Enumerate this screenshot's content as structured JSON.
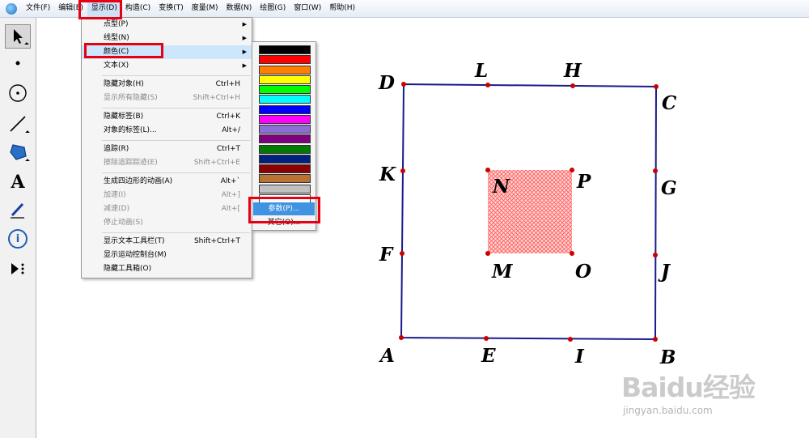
{
  "menubar": {
    "items": [
      "文件(F)",
      "编辑(E)",
      "显示(D)",
      "构造(C)",
      "变换(T)",
      "度量(M)",
      "数据(N)",
      "绘图(G)",
      "窗口(W)",
      "帮助(H)"
    ],
    "active": "显示(D)"
  },
  "toolbox": {
    "tools": [
      {
        "name": "arrow-tool",
        "icon": "arrow-icon"
      },
      {
        "name": "point-tool",
        "icon": "point-icon"
      },
      {
        "name": "compass-tool",
        "icon": "compass-icon"
      },
      {
        "name": "line-tool",
        "icon": "line-icon"
      },
      {
        "name": "polygon-tool",
        "icon": "polygon-icon"
      },
      {
        "name": "text-tool",
        "icon": "text-icon",
        "glyph": "A"
      },
      {
        "name": "marker-tool",
        "icon": "marker-icon"
      },
      {
        "name": "information-tool",
        "icon": "info-icon",
        "glyph": "i"
      },
      {
        "name": "custom-tool",
        "icon": "custom-tool-icon"
      }
    ]
  },
  "display_menu": {
    "items": [
      {
        "label": "点型(P)",
        "shortcut": "",
        "submenu": true,
        "disabled": false
      },
      {
        "label": "线型(N)",
        "shortcut": "",
        "submenu": true,
        "disabled": false
      },
      {
        "label": "颜色(C)",
        "shortcut": "",
        "submenu": true,
        "disabled": false,
        "highlight": true
      },
      {
        "label": "文本(X)",
        "shortcut": "",
        "submenu": true,
        "disabled": false
      },
      {
        "label": "隐藏对象(H)",
        "shortcut": "Ctrl+H",
        "submenu": false,
        "disabled": false
      },
      {
        "label": "显示所有隐藏(S)",
        "shortcut": "Shift+Ctrl+H",
        "submenu": false,
        "disabled": true
      },
      {
        "label": "隐藏标签(B)",
        "shortcut": "Ctrl+K",
        "submenu": false,
        "disabled": false
      },
      {
        "label": "对象的标签(L)...",
        "shortcut": "Alt+/",
        "submenu": false,
        "disabled": false
      },
      {
        "label": "追踪(R)",
        "shortcut": "Ctrl+T",
        "submenu": false,
        "disabled": false
      },
      {
        "label": "擦除追踪踪迹(E)",
        "shortcut": "Shift+Ctrl+E",
        "submenu": false,
        "disabled": true
      },
      {
        "label": "生成四边形的动画(A)",
        "shortcut": "Alt+`",
        "submenu": false,
        "disabled": false
      },
      {
        "label": "加速(I)",
        "shortcut": "Alt+]",
        "submenu": false,
        "disabled": true
      },
      {
        "label": "减速(D)",
        "shortcut": "Alt+[",
        "submenu": false,
        "disabled": true
      },
      {
        "label": "停止动画(S)",
        "shortcut": "",
        "submenu": false,
        "disabled": true
      },
      {
        "label": "显示文本工具栏(T)",
        "shortcut": "Shift+Ctrl+T",
        "submenu": false,
        "disabled": false
      },
      {
        "label": "显示运动控制台(M)",
        "shortcut": "",
        "submenu": false,
        "disabled": false
      },
      {
        "label": "隐藏工具箱(O)",
        "shortcut": "",
        "submenu": false,
        "disabled": false
      }
    ]
  },
  "color_menu": {
    "swatches": [
      "#000000",
      "#ff0000",
      "#ff8000",
      "#ffff00",
      "#00ff00",
      "#00ffff",
      "#0000ff",
      "#ff00ff",
      "#8a6fd6",
      "#800080",
      "#007a00",
      "#002080",
      "#8b0000",
      "#b87333",
      "#c0c0c0",
      "#ffffff"
    ],
    "parameter_label": "参数(P)...",
    "other_label": "其它(O)..."
  },
  "geometry": {
    "outer_color": "#1a1a8c",
    "inner_fill": "#ff6060",
    "point_color": "#cc0000",
    "points": [
      "A",
      "B",
      "C",
      "D",
      "E",
      "F",
      "G",
      "H",
      "I",
      "J",
      "K",
      "L",
      "M",
      "N",
      "O",
      "P"
    ]
  },
  "watermark": {
    "logo_text": "Baidu经验",
    "url": "jingyan.baidu.com"
  }
}
